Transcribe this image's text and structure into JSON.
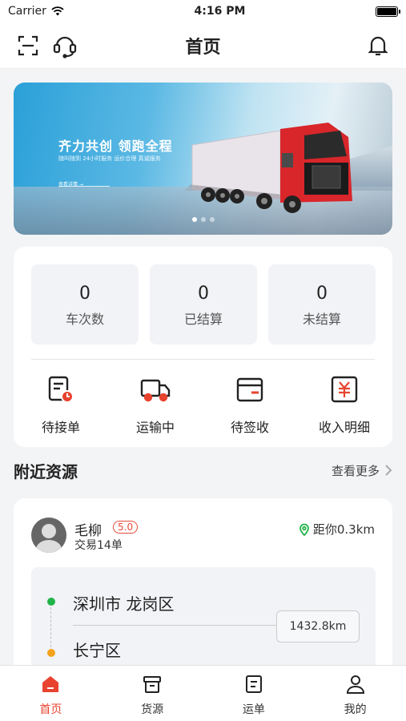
{
  "status_bar": {
    "carrier": "Carrier",
    "time": "4:16 PM"
  },
  "nav": {
    "title": "首页",
    "scan_icon": "scan-icon",
    "support_icon": "headset-icon",
    "bell_icon": "bell-icon"
  },
  "banner": {
    "headline": "齐力共创 领跑全程",
    "subline": "随叫随到 24小时服务 运价合理 真诚服务",
    "cta": "查看详情 →",
    "slide_count": 3,
    "active_slide": 1
  },
  "stats": [
    {
      "value": "0",
      "label": "车次数"
    },
    {
      "value": "0",
      "label": "已结算"
    },
    {
      "value": "0",
      "label": "未结算"
    }
  ],
  "actions": [
    {
      "label": "待接单",
      "icon": "pending-order-icon"
    },
    {
      "label": "运输中",
      "icon": "truck-icon"
    },
    {
      "label": "待签收",
      "icon": "package-icon"
    },
    {
      "label": "收入明细",
      "icon": "income-icon"
    }
  ],
  "nearby": {
    "title": "附近资源",
    "more": "查看更多",
    "card": {
      "name": "毛柳",
      "rating": "5.0",
      "deals": "交易14单",
      "distance": "距你0.3km",
      "from": "深圳市 龙岗区",
      "to": "长宁区",
      "route_km": "1432.8km"
    }
  },
  "tabbar": [
    {
      "label": "首页",
      "icon": "home-icon",
      "active": true
    },
    {
      "label": "货源",
      "icon": "cargo-box-icon",
      "active": false
    },
    {
      "label": "运单",
      "icon": "waybill-icon",
      "active": false
    },
    {
      "label": "我的",
      "icon": "profile-icon",
      "active": false
    }
  ],
  "colors": {
    "accent": "#e8432f",
    "start_dot": "#21b34a",
    "end_dot": "#f3a21c"
  }
}
